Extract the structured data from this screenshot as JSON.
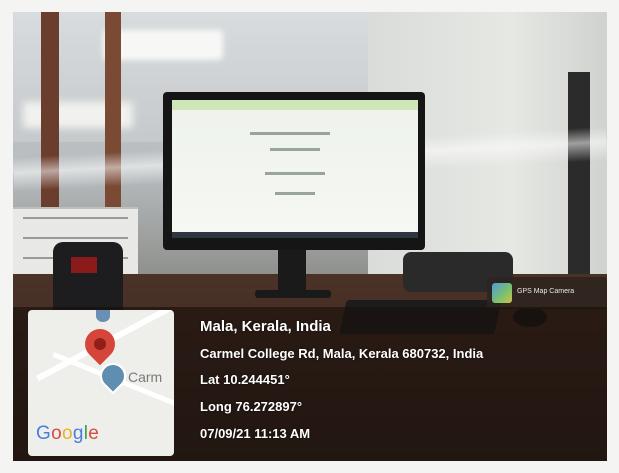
{
  "location": {
    "city_line": "Mala, Kerala, India",
    "address": "Carmel College Rd, Mala, Kerala 680732, India",
    "latitude": "Lat 10.244451°",
    "longitude": "Long 76.272897°",
    "datetime": "07/09/21 11:13 AM"
  },
  "map": {
    "place_label": "Carm",
    "logo_letters": [
      "G",
      "o",
      "o",
      "g",
      "l",
      "e"
    ],
    "pin_color": "#d6453a"
  },
  "app_badge": {
    "label": "GPS Map Camera",
    "icon": "gps-map-camera-icon"
  }
}
